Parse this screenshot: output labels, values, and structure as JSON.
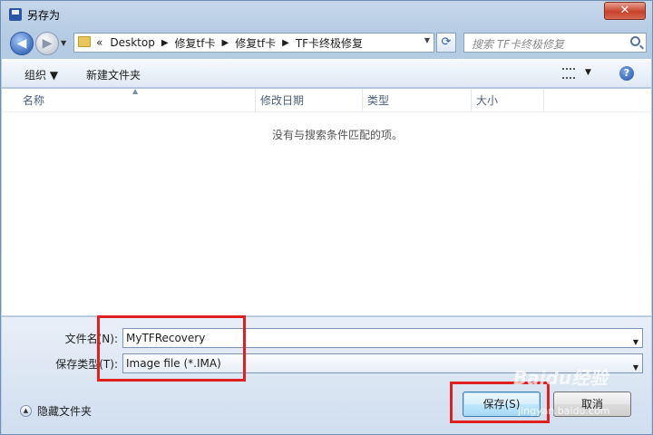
{
  "window": {
    "title": "另存为",
    "close_label": "✕"
  },
  "nav": {
    "back_glyph": "◀",
    "forward_glyph": "▶",
    "breadcrumbs": [
      "«",
      "Desktop",
      "修复tf卡",
      "修复tf卡",
      "TF卡终极修复"
    ],
    "search_placeholder": "搜索 TF卡终极修复"
  },
  "toolbar": {
    "organize_label": "组织 ▼",
    "new_folder_label": "新建文件夹",
    "help_label": "?"
  },
  "columns": [
    "名称",
    "修改日期",
    "类型",
    "大小"
  ],
  "empty_message": "没有与搜索条件匹配的项。",
  "form": {
    "filename_label": "文件名(N):",
    "filename_value": "MyTFRecovery",
    "filetype_label": "保存类型(T):",
    "filetype_value": "Image file (*.IMA)"
  },
  "footer": {
    "hide_folders_label": "隐藏文件夹",
    "save_label": "保存(S)",
    "cancel_label": "取消"
  },
  "watermark": {
    "text": "Baidu经验",
    "subtext": "jingyan.baidu.com"
  },
  "colors": {
    "highlight": "#e0201e",
    "close": "#c7432c"
  }
}
